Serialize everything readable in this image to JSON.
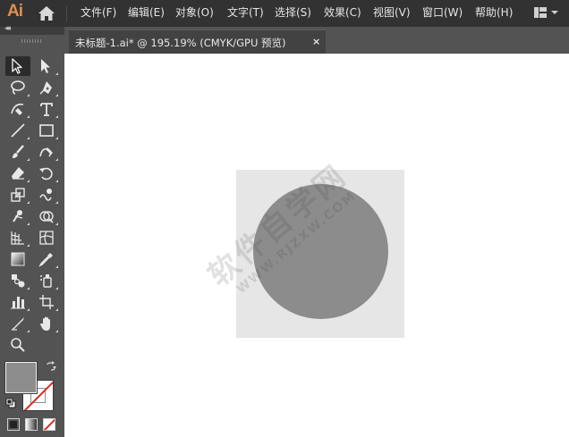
{
  "app": {
    "logo": "Ai"
  },
  "menu": [
    "文件(F)",
    "编辑(E)",
    "对象(O)",
    "文字(T)",
    "选择(S)",
    "效果(C)",
    "视图(V)",
    "窗口(W)",
    "帮助(H)"
  ],
  "tools_panel": {
    "collapse_label": "◂◂",
    "tools": [
      "selection-tool",
      "direct-selection-tool",
      "lasso-tool",
      "pen-tool",
      "curvature-tool",
      "type-tool",
      "line-segment-tool",
      "rectangle-tool",
      "paintbrush-tool",
      "shaper-tool",
      "eraser-tool",
      "rotate-tool",
      "scale-tool",
      "warp-tool",
      "puppet-warp-tool",
      "shape-builder-tool",
      "perspective-grid-tool",
      "mesh-tool",
      "gradient-tool",
      "eyedropper-tool",
      "blend-tool",
      "symbol-sprayer-tool",
      "column-graph-tool",
      "artboard-tool",
      "slice-tool",
      "hand-tool",
      "zoom-tool"
    ],
    "fill_color": "#8d8d8d",
    "stroke": "none"
  },
  "document": {
    "tab_title": "未标题-1.ai* @ 195.19% (CMYK/GPU 预览)",
    "close_label": "×"
  },
  "canvas": {
    "square_color": "#e6e6e6",
    "circle_color": "#8c8c8c",
    "watermark_main": "软件自学网",
    "watermark_sub": "WWW.RJZXW.COM"
  }
}
